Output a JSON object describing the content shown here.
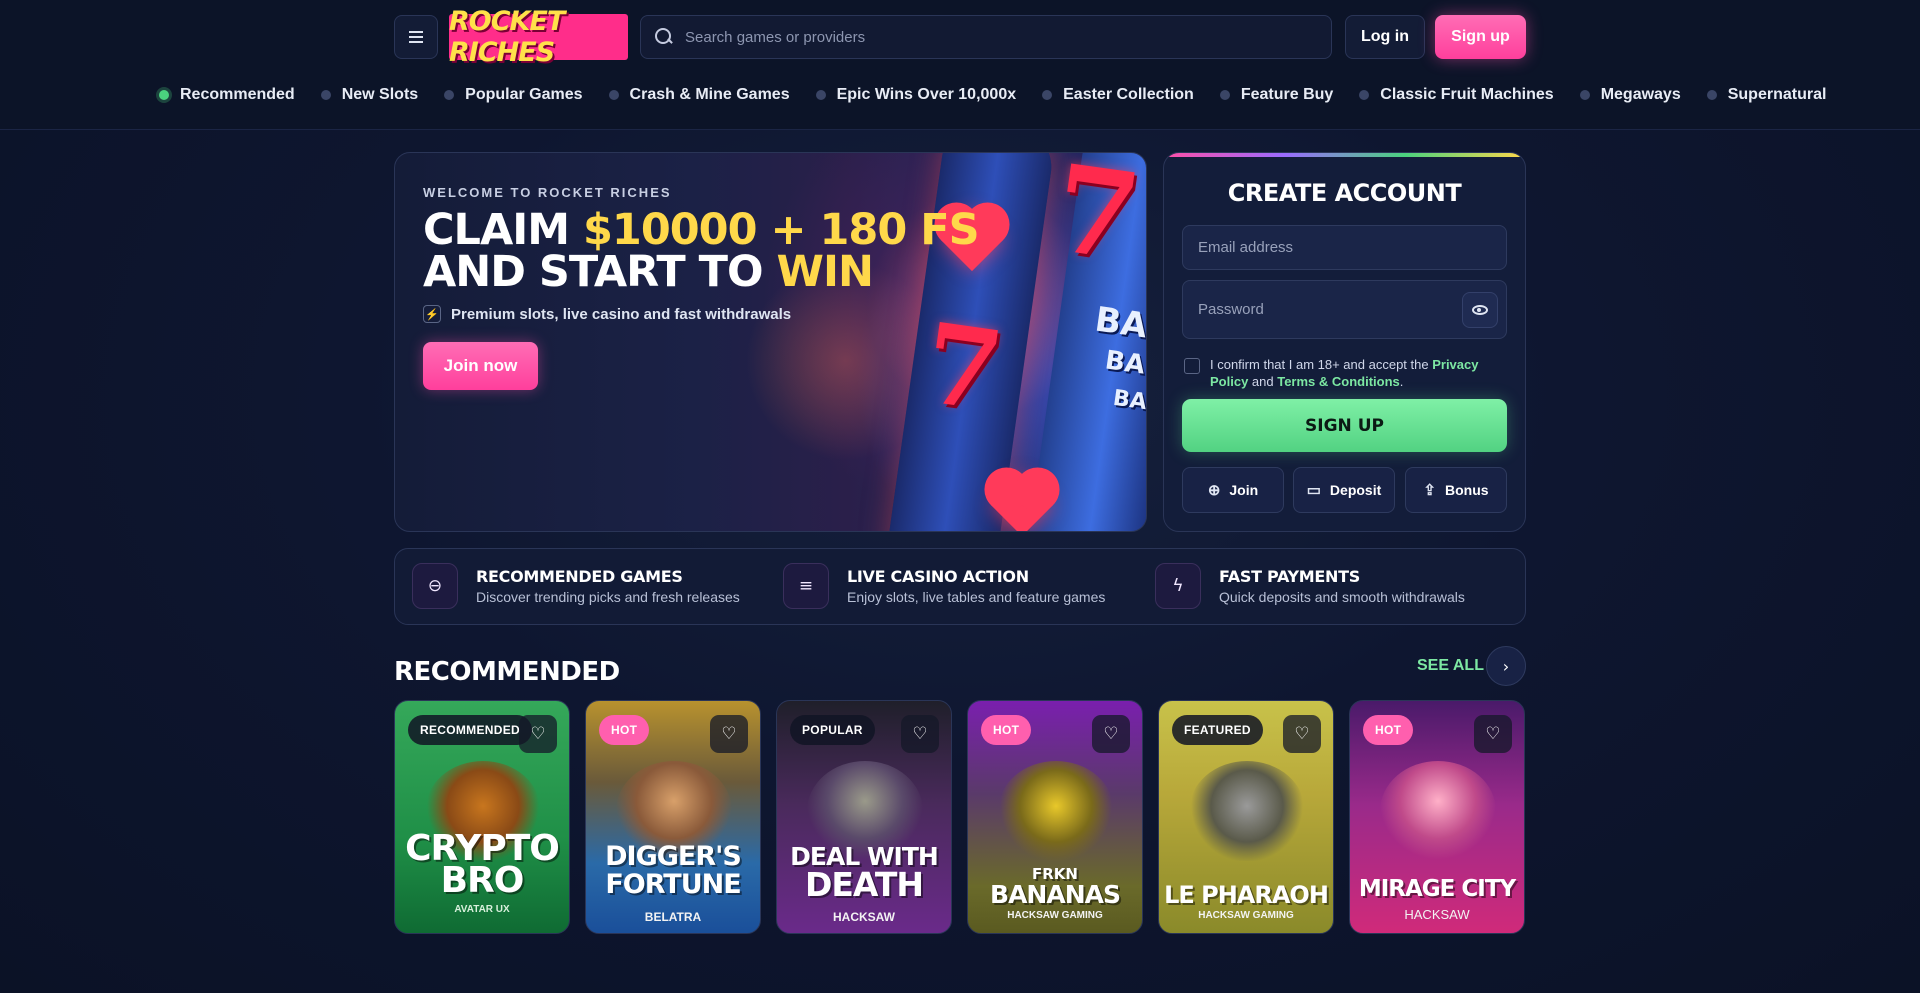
{
  "header": {
    "logo_text": "ROCKET RICHES",
    "search_placeholder": "Search games or providers",
    "login_label": "Log in",
    "signup_label": "Sign up"
  },
  "categories": [
    {
      "label": "Recommended",
      "active": true
    },
    {
      "label": "New Slots",
      "active": false
    },
    {
      "label": "Popular Games",
      "active": false
    },
    {
      "label": "Crash & Mine Games",
      "active": false
    },
    {
      "label": "Epic Wins Over 10,000x",
      "active": false
    },
    {
      "label": "Easter Collection",
      "active": false
    },
    {
      "label": "Feature Buy",
      "active": false
    },
    {
      "label": "Classic Fruit Machines",
      "active": false
    },
    {
      "label": "Megaways",
      "active": false
    },
    {
      "label": "Supernatural",
      "active": false
    }
  ],
  "hero": {
    "kicker": "WELCOME TO ROCKET RICHES",
    "title_line1_a": "CLAIM ",
    "title_line1_b": "$10000 + 180 FS",
    "title_line2_a": "AND START TO ",
    "title_line2_b": "WIN",
    "subtitle": "Premium slots, live casino and fast withdrawals",
    "cta_label": "Join now"
  },
  "create_account": {
    "title": "CREATE ACCOUNT",
    "email_placeholder": "Email address",
    "password_placeholder": "Password",
    "consent_prefix": "I confirm that I am 18+ and accept the ",
    "privacy_label": "Privacy Policy",
    "consent_and": " and ",
    "terms_label": "Terms & Conditions",
    "consent_suffix": ".",
    "submit_label": "SIGN UP",
    "quick_actions": [
      {
        "label": "Join",
        "icon": "plus-circle-icon"
      },
      {
        "label": "Deposit",
        "icon": "wallet-icon"
      },
      {
        "label": "Bonus",
        "icon": "share-icon"
      }
    ]
  },
  "features": [
    {
      "title": "RECOMMENDED GAMES",
      "subtitle": "Discover trending picks and fresh releases",
      "icon": "minus-circle-icon"
    },
    {
      "title": "LIVE CASINO ACTION",
      "subtitle": "Enjoy slots, live tables and feature games",
      "icon": "lines-icon"
    },
    {
      "title": "FAST PAYMENTS",
      "subtitle": "Quick deposits and smooth withdrawals",
      "icon": "bolt-icon"
    }
  ],
  "recommended": {
    "title": "RECOMMENDED",
    "see_all_label": "SEE ALL",
    "games": [
      {
        "badge": "RECOMMENDED",
        "badge_style": "dark",
        "title_line1": "CRYPTO",
        "title_line2": "BRO",
        "provider": "AVATAR UX"
      },
      {
        "badge": "HOT",
        "badge_style": "pink",
        "title_line1": "DIGGER'S",
        "title_line2": "FORTUNE",
        "provider": "BELATRA"
      },
      {
        "badge": "POPULAR",
        "badge_style": "dark",
        "title_line1": "DEAL WITH",
        "title_line2": "DEATH",
        "provider": "HACKSAW"
      },
      {
        "badge": "HOT",
        "badge_style": "pink",
        "title_line1": "FRKN",
        "title_line2": "BANANAS",
        "provider": "HACKSAW GAMING"
      },
      {
        "badge": "FEATURED",
        "badge_style": "dark",
        "title_line1": "",
        "title_line2": "LE PHARAOH",
        "provider": "HACKSAW GAMING"
      },
      {
        "badge": "HOT",
        "badge_style": "pink",
        "title_line1": "",
        "title_line2": "MIRAGE CITY",
        "provider": "HACKSAW"
      }
    ]
  },
  "colors": {
    "accent_pink": "#ff4fa7",
    "accent_green": "#7de8a3",
    "accent_yellow": "#ffd84a",
    "background": "#0e1630"
  }
}
